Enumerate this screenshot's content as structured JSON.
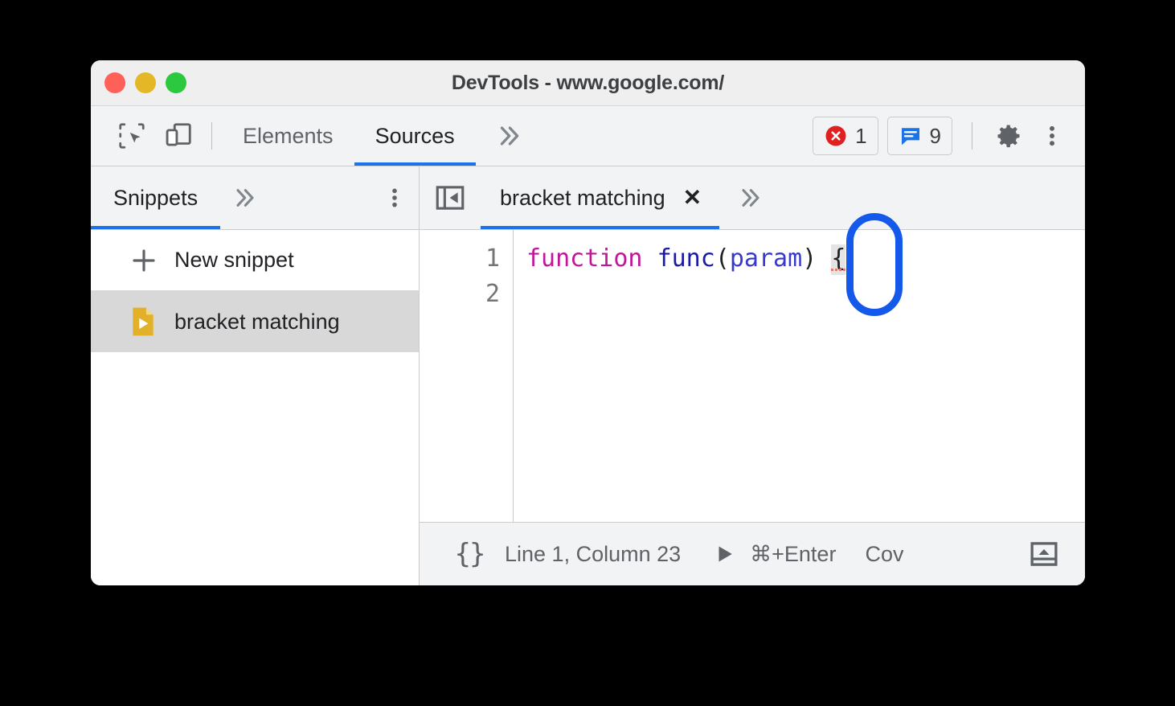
{
  "window": {
    "title": "DevTools - www.google.com/",
    "traffic_lights": [
      {
        "name": "close",
        "color": "#ff6057"
      },
      {
        "name": "minimize",
        "color": "#e3b726"
      },
      {
        "name": "maximize",
        "color": "#2bc840"
      }
    ]
  },
  "toolbar": {
    "inspect_icon": "inspect-element-icon",
    "device_icon": "device-toolbar-icon",
    "tabs": [
      {
        "label": "Elements",
        "active": false
      },
      {
        "label": "Sources",
        "active": true
      }
    ],
    "more_tabs_icon": "chevron-double-right-icon",
    "error_badge": {
      "icon": "error-circle-icon",
      "count": "1",
      "color": "#e02020"
    },
    "message_badge": {
      "icon": "message-bubble-icon",
      "count": "9",
      "color": "#1a73e8"
    },
    "settings_icon": "gear-icon",
    "menu_icon": "kebab-menu-icon",
    "accent_color": "#1a73e8"
  },
  "sidebar": {
    "tabs": [
      {
        "label": "Snippets",
        "active": true
      }
    ],
    "more_icon": "chevron-double-right-icon",
    "menu_icon": "kebab-menu-icon",
    "items": [
      {
        "label": "New snippet",
        "icon": "plus-icon",
        "selected": false
      },
      {
        "label": "bracket matching",
        "icon": "snippet-file-icon",
        "selected": true
      }
    ]
  },
  "editor": {
    "collapse_icon": "collapse-sidebar-icon",
    "tab": {
      "label": "bracket matching",
      "close_icon": "close-icon"
    },
    "more_icon": "chevron-double-right-icon",
    "line_numbers": [
      "1",
      "2"
    ],
    "code": {
      "line1": {
        "keyword": "function",
        "space1": " ",
        "fn_name": "func",
        "paren_open": "(",
        "param": "param",
        "paren_close": ")",
        "space2": " ",
        "brace": "{"
      },
      "line2": ""
    },
    "annotation": {
      "shape": "rounded-rect-outline",
      "color": "#1559ea",
      "target": "{"
    },
    "syntax_colors": {
      "keyword": "#c0179a",
      "function": "#1a1aa6",
      "param": "#3939cc",
      "punctuation": "#202124",
      "error_underline": "#e8776f"
    }
  },
  "statusbar": {
    "pretty_print_icon": "{}",
    "position": "Line 1, Column 23",
    "run_icon": "play-icon",
    "run_shortcut": "⌘+Enter",
    "coverage_label": "Cov",
    "drawer_icon": "show-drawer-icon"
  }
}
